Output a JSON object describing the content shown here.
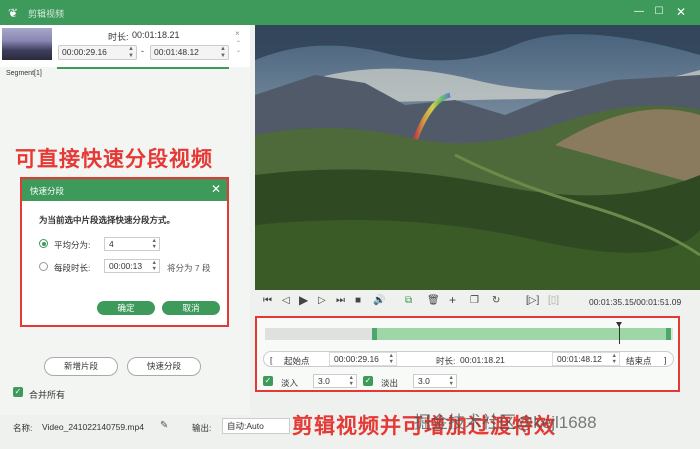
{
  "window": {
    "title": "剪辑视频",
    "icon": "rabbit-icon",
    "accent": "#3d9a5a",
    "annotation_color": "#e53935"
  },
  "segment_list": {
    "duration_label": "时长:",
    "duration_value": "00:01:18.21",
    "start_time": "00:00:29.16",
    "end_time": "00:01:48.12",
    "separator": "-",
    "segment_label": "Segment[1]",
    "close_glyph": "×"
  },
  "annotations": {
    "top": "可直接快速分段视频",
    "bottom": "剪辑视频并可增加过渡特效",
    "watermark": "掘金技术社区@kejl1688"
  },
  "quick_split_dialog": {
    "title": "快速分段",
    "prompt": "为当前选中片段选择快速分段方式。",
    "option_equal_label": "平均分为:",
    "option_equal_value": "4",
    "option_duration_label": "每段时长:",
    "option_duration_value": "00:00:13",
    "option_duration_note": "将分为 7 段",
    "confirm_label": "确定",
    "cancel_label": "取消"
  },
  "left_actions": {
    "new_segment_label": "新增片段",
    "quick_split_label": "快速分段",
    "merge_all_label": "合并所有",
    "merge_all_checked": true
  },
  "bottom_bar": {
    "name_label": "名称:",
    "file_name": "Video_241022140759.mp4",
    "output_label": "输出:",
    "output_value": "自动:Auto"
  },
  "player": {
    "time_display": "00:01:35.15/00:01:51.09"
  },
  "editor": {
    "start_bracket": "[",
    "start_label": "起始点",
    "start_value": "00:00:29.16",
    "duration_label": "时长:",
    "duration_value": "00:01:18.21",
    "end_value": "00:01:48.12",
    "end_label": "结束点",
    "end_bracket": "]",
    "fade_in_label": "淡入",
    "fade_in_value": "3.0",
    "fade_out_label": "淡出",
    "fade_out_value": "3.0",
    "fade_in_checked": true,
    "fade_out_checked": true
  }
}
